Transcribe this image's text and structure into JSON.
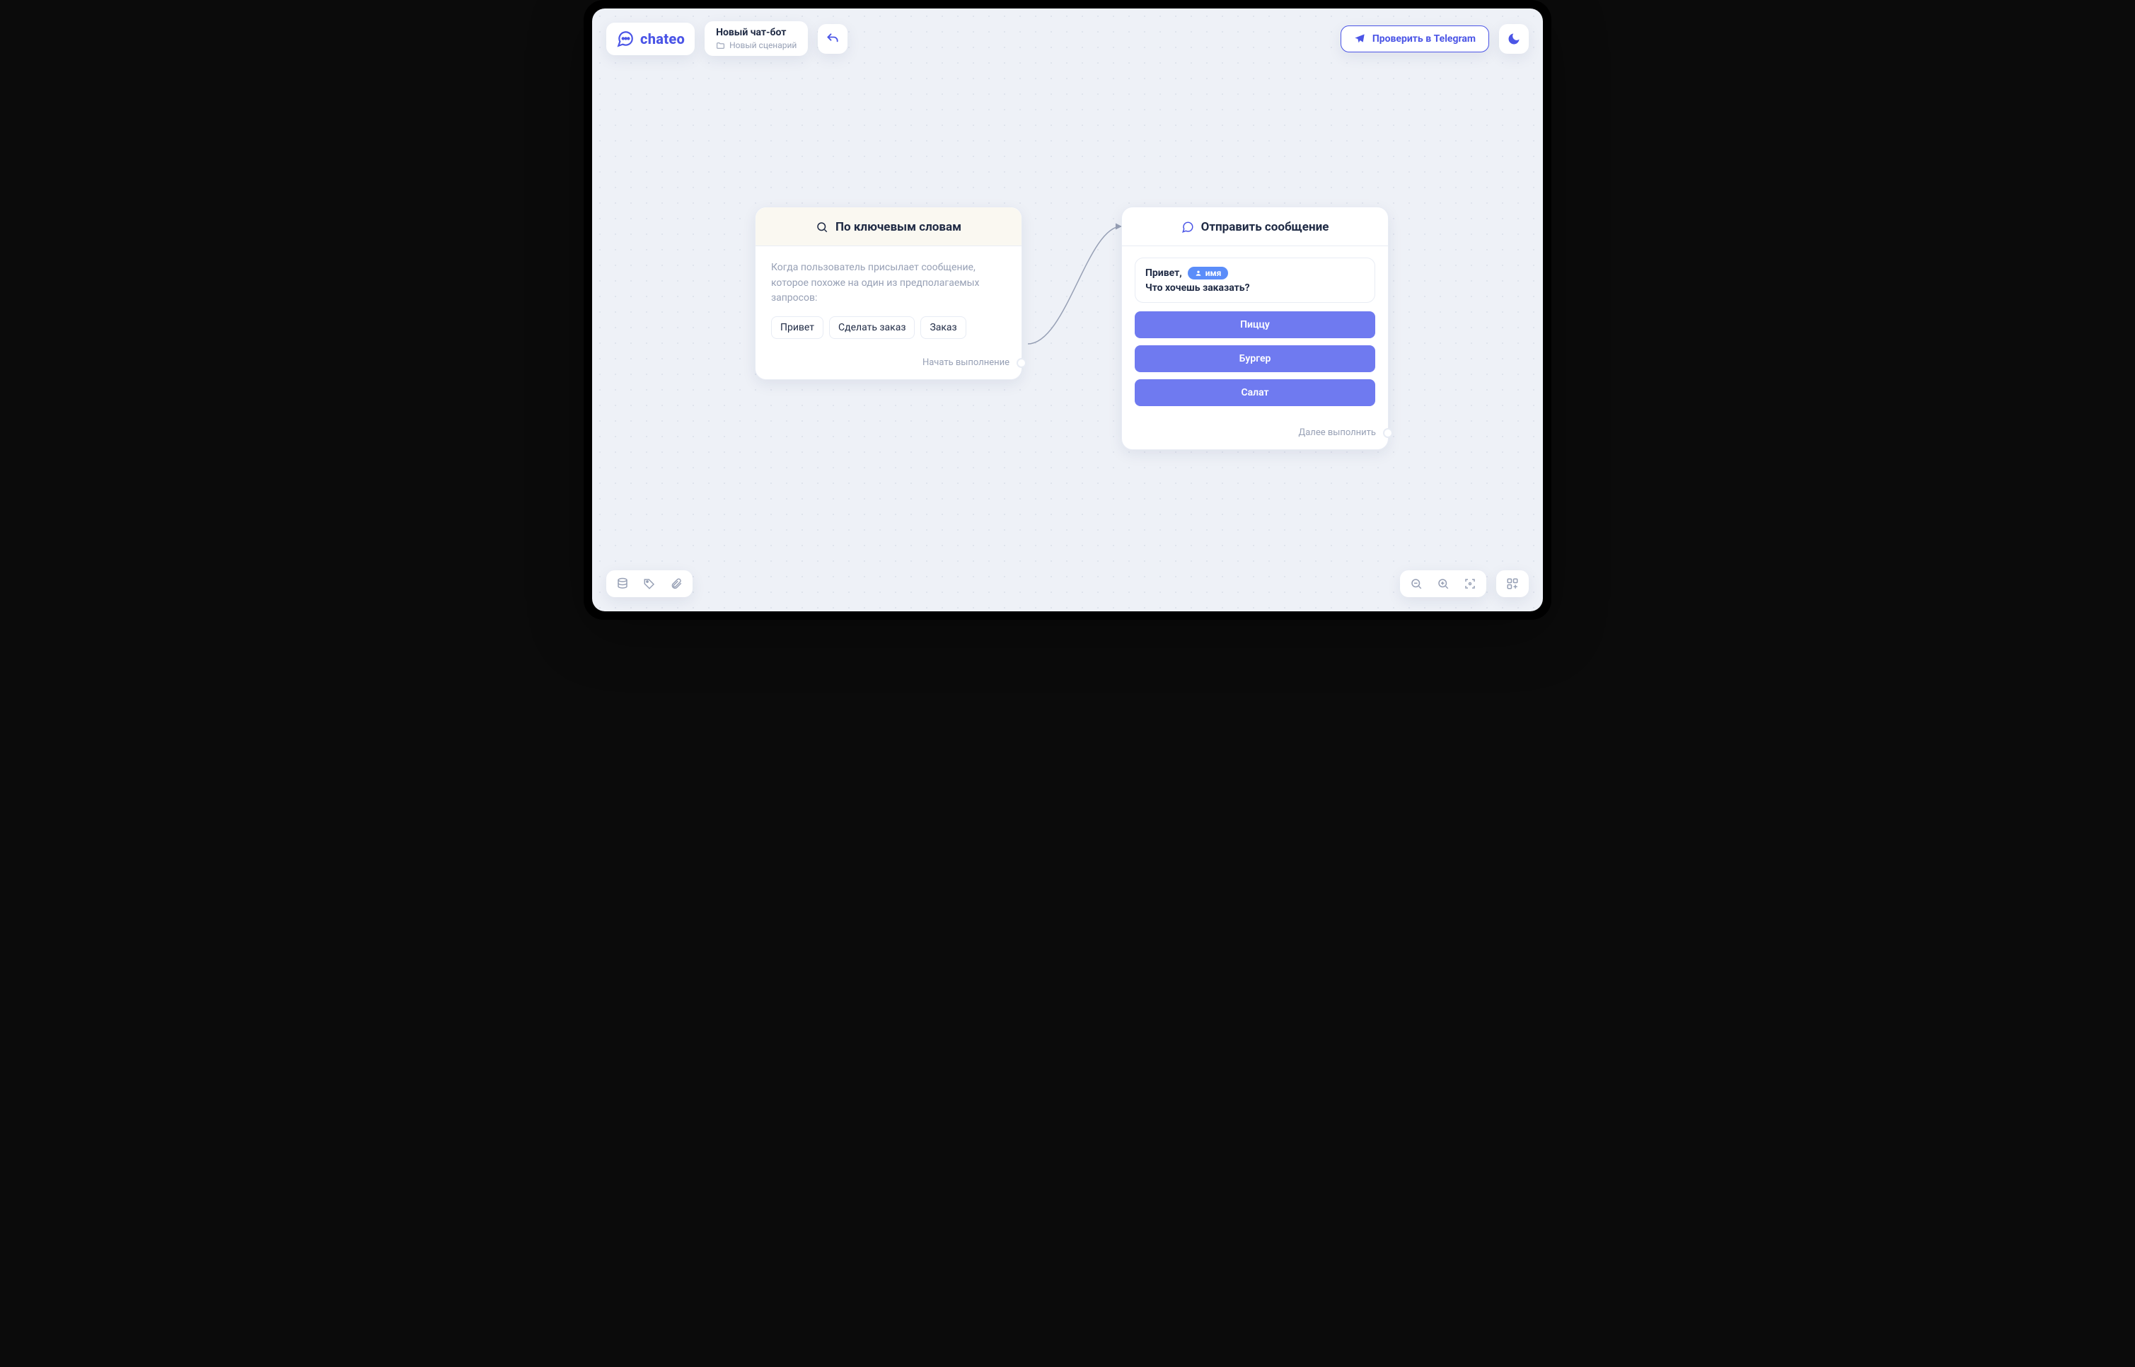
{
  "brand": {
    "name": "chateo"
  },
  "header": {
    "bot_title": "Новый чат-бот",
    "scenario_label": "Новый сценарий",
    "test_button": "Проверить в Telegram"
  },
  "node_keywords": {
    "title": "По ключевым словам",
    "description": "Когда пользователь присылает сообщение, которое похоже на один из предполагаемых запросов:",
    "keywords": [
      "Привет",
      "Сделать заказ",
      "Заказ"
    ],
    "footer": "Начать выполнение"
  },
  "node_message": {
    "title": "Отправить сообщение",
    "greeting_prefix": "Привет,",
    "name_tag": "имя",
    "question": "Что хочешь заказать?",
    "options": [
      "Пиццу",
      "Бургер",
      "Салат"
    ],
    "footer": "Далее выполнить"
  },
  "colors": {
    "brand": "#4b55e6",
    "brand_soft": "#6f7af0",
    "bg": "#eef1f7"
  }
}
